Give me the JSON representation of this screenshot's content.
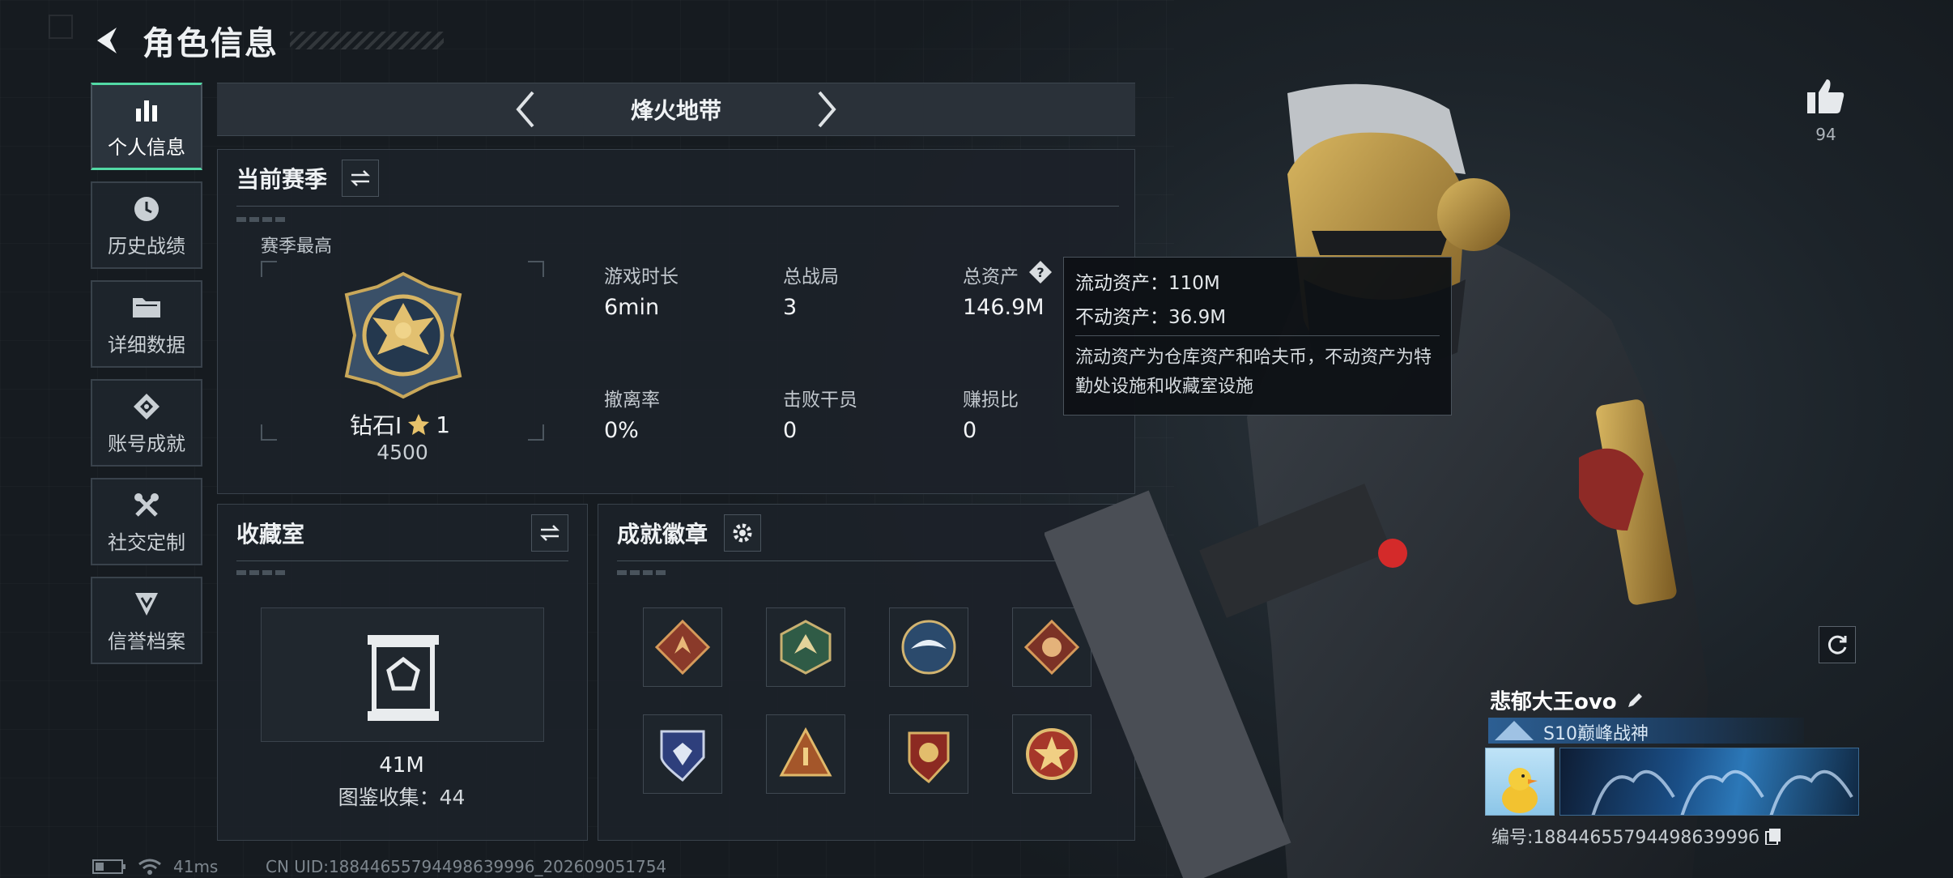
{
  "header": {
    "title": "角色信息"
  },
  "sidebar": {
    "items": [
      {
        "label": "个人信息",
        "icon": "bar-chart-icon",
        "active": true
      },
      {
        "label": "历史战绩",
        "icon": "clock-icon"
      },
      {
        "label": "详细数据",
        "icon": "folder-icon"
      },
      {
        "label": "账号成就",
        "icon": "medal-icon"
      },
      {
        "label": "社交定制",
        "icon": "tools-icon"
      },
      {
        "label": "信誉档案",
        "icon": "shield-rank-icon"
      }
    ]
  },
  "mode": {
    "name": "烽火地带"
  },
  "season": {
    "title": "当前赛季",
    "best_label": "赛季最高",
    "rank_name": "钻石Ⅰ",
    "rank_stars": "1",
    "rank_score": "4500",
    "stats": [
      {
        "label": "游戏时长",
        "value": "6min"
      },
      {
        "label": "总战局",
        "value": "3"
      },
      {
        "label": "总资产",
        "value": "146.9M"
      },
      {
        "label": "撤离率",
        "value": "0%"
      },
      {
        "label": "击败干员",
        "value": "0"
      },
      {
        "label": "赚损比",
        "value": "0"
      }
    ]
  },
  "tooltip": {
    "liquid": "流动资产：110M",
    "fixed": "不动资产：36.9M",
    "desc": "流动资产为仓库资产和哈夫币，不动资产为特勤处设施和收藏室设施"
  },
  "collection": {
    "title": "收藏室",
    "value": "41M",
    "codex": "图鉴收集：44"
  },
  "badges": {
    "title": "成就徽章",
    "items": [
      "dragon-badge-red",
      "dragon-badge-green",
      "eagle-badge-blue",
      "wolf-badge-red",
      "shield-badge-blue",
      "pyramid-badge-gold",
      "star-badge-red",
      "star-badge-gold"
    ]
  },
  "player": {
    "likes": "94",
    "name": "悲郁大王ovo",
    "title": "S10巅峰战神",
    "id": "编号:1884465579449863999б"
  },
  "status": {
    "ping": "41ms",
    "uid": "CN UID:18844655794498639996_202609051754"
  },
  "colors": {
    "accent": "#52d9a5",
    "panel": "#1c2229",
    "background": "#1a2027"
  }
}
